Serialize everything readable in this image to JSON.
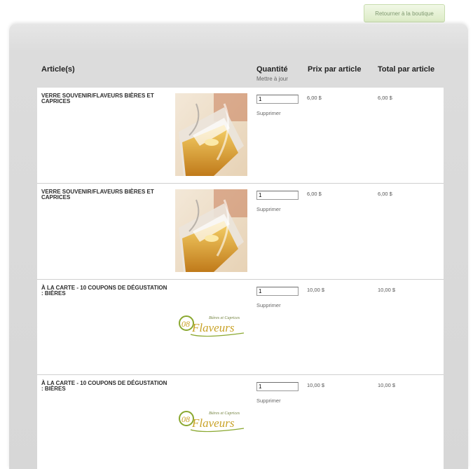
{
  "top": {
    "back_button": "Retourner à la boutique"
  },
  "headers": {
    "article": "Article(s)",
    "quantity": "Quantité",
    "update": "Mettre à jour",
    "price": "Prix par article",
    "total": "Total par article"
  },
  "items": [
    {
      "name": "VERRE SOUVENIR/FLAVEURS BIÈRES ET CAPRICES",
      "image": "beer-glass-photo",
      "qty": "1",
      "remove": "Supprimer",
      "price": "6,00 $",
      "total": "6,00 $"
    },
    {
      "name": "VERRE SOUVENIR/FLAVEURS BIÈRES ET CAPRICES",
      "image": "beer-glass-photo",
      "qty": "1",
      "remove": "Supprimer",
      "price": "6,00 $",
      "total": "6,00 $"
    },
    {
      "name": "À LA CARTE - 10 COUPONS DE DÉGUSTATION : BIÈRES",
      "image": "flaveurs-logo",
      "qty": "1",
      "remove": "Supprimer",
      "price": "10,00 $",
      "total": "10,00 $"
    },
    {
      "name": "À LA CARTE - 10 COUPONS DE DÉGUSTATION : BIÈRES",
      "image": "flaveurs-logo",
      "qty": "1",
      "remove": "Supprimer",
      "price": "10,00 $",
      "total": "10,00 $"
    }
  ],
  "logo": {
    "small": "08",
    "tagline": "Bières et Caprices",
    "word": "Flaveurs"
  },
  "colors": {
    "logo_gold": "#c9a227",
    "logo_green": "#8aa830",
    "button_bg": "#e6f2d6"
  }
}
